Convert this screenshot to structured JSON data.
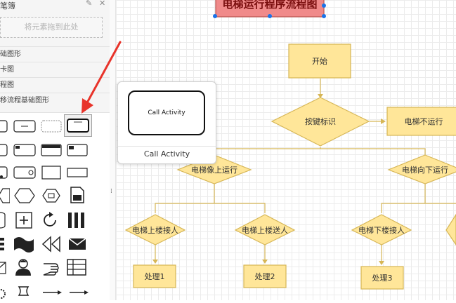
{
  "sidebar": {
    "title": "笔簿",
    "edit_icon": "✎",
    "close_icon": "✕",
    "drop_zone_text": "将元素拖到此处",
    "categories": [
      {
        "label": "础图形"
      },
      {
        "label": "卡图"
      },
      {
        "label": "程图"
      },
      {
        "label": "移流程基础图形"
      }
    ]
  },
  "preview": {
    "shape_label": "Call Activity",
    "caption": "Call Activity"
  },
  "flowchart": {
    "title": "电梯运行程序流程图",
    "nodes": {
      "start": "开始",
      "key_identify": "按键标识",
      "not_running": "电梯不运行",
      "up": "电梯像上运行",
      "down": "电梯向下运行",
      "up_pick": "电梯上楼接人",
      "up_send": "电梯上楼送人",
      "down_pick": "电梯下楼接人",
      "proc1": "处理1",
      "proc2": "处理2",
      "proc3": "处理3"
    }
  },
  "colors": {
    "title_fill": "#f08a8a",
    "title_stroke": "#b85450",
    "node_fill": "#ffe699",
    "node_stroke": "#d6b656",
    "connector": "#d6b656",
    "selection_handle": "#1a73e8",
    "annotation_arrow": "#e8332a"
  }
}
